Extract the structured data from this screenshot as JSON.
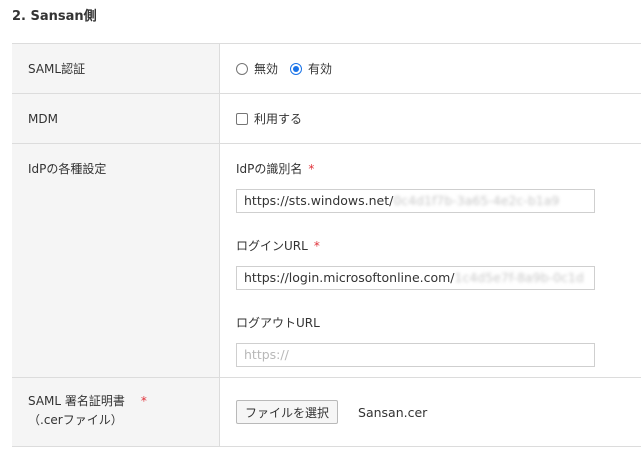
{
  "section": {
    "title": "2. Sansan側"
  },
  "saml": {
    "label": "SAML認証",
    "options": [
      {
        "label": "無効",
        "checked": false
      },
      {
        "label": "有効",
        "checked": true
      }
    ]
  },
  "mdm": {
    "label": "MDM",
    "checkbox_label": "利用する",
    "checked": false
  },
  "idp": {
    "label": "IdPの各種設定",
    "identifier": {
      "label": "IdPの識別名",
      "required_mark": "*",
      "value_visible": "https://sts.windows.net/",
      "value_obscured": "0c4d1f7b-3a65-4e2c-b1a9"
    },
    "login_url": {
      "label": "ログインURL",
      "required_mark": "*",
      "value_visible": "https://login.microsoftonline.com/",
      "value_obscured": "1c4d5e7f-8a9b-0c1d"
    },
    "logout_url": {
      "label": "ログアウトURL",
      "placeholder": "https://"
    }
  },
  "cert": {
    "label_line1": "SAML 署名証明書",
    "required_mark": "*",
    "label_line2": "（.cerファイル）",
    "button_label": "ファイルを選択",
    "file_name": "Sansan.cer"
  }
}
